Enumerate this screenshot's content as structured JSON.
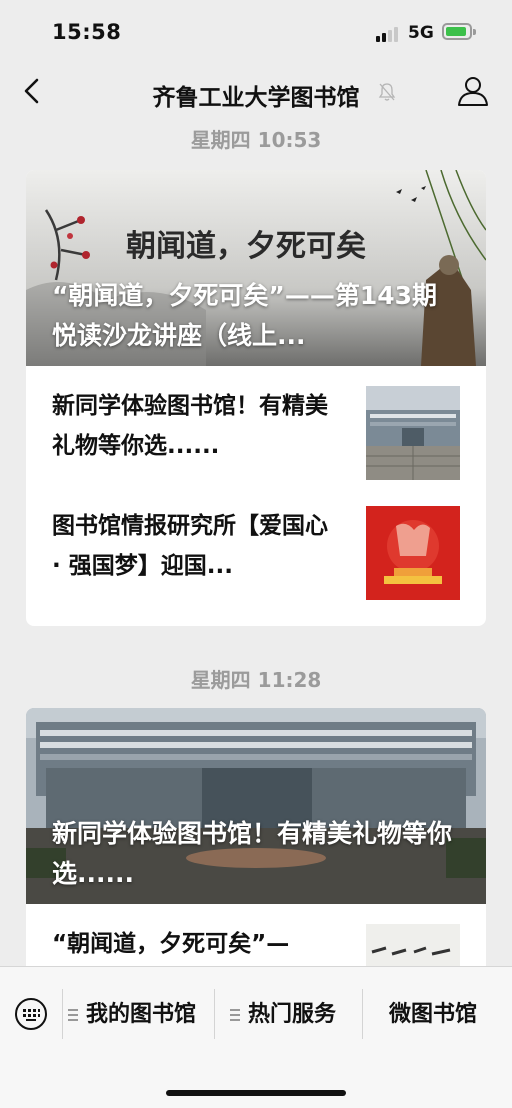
{
  "status_bar": {
    "time": "15:58",
    "network": "5G",
    "battery_charging": true
  },
  "nav": {
    "title": "齐鲁工业大学图书馆",
    "muted": true
  },
  "groups": [
    {
      "time": "星期四 10:53",
      "hero": {
        "title": "“朝闻道，夕死可矣”——第143期悦读沙龙讲座（线上...",
        "banner_text": "朝闻道，夕死可矣"
      },
      "items": [
        {
          "title": "新同学体验图书馆！有精美礼物等你选......"
        },
        {
          "title": "图书馆情报研究所【爱国心 · 强国梦】迎国..."
        }
      ]
    },
    {
      "time": "星期四 11:28",
      "hero": {
        "title": "新同学体验图书馆！有精美礼物等你选......"
      },
      "items": [
        {
          "title": "“朝闻道，夕死可矣”—"
        }
      ]
    }
  ],
  "bottom_menu": {
    "items": [
      "我的图书馆",
      "热门服务",
      "微图书馆"
    ]
  },
  "colors": {
    "background": "#ededed",
    "card": "#ffffff",
    "time_label": "#9b9b9b",
    "battery": "#3cc04a"
  }
}
